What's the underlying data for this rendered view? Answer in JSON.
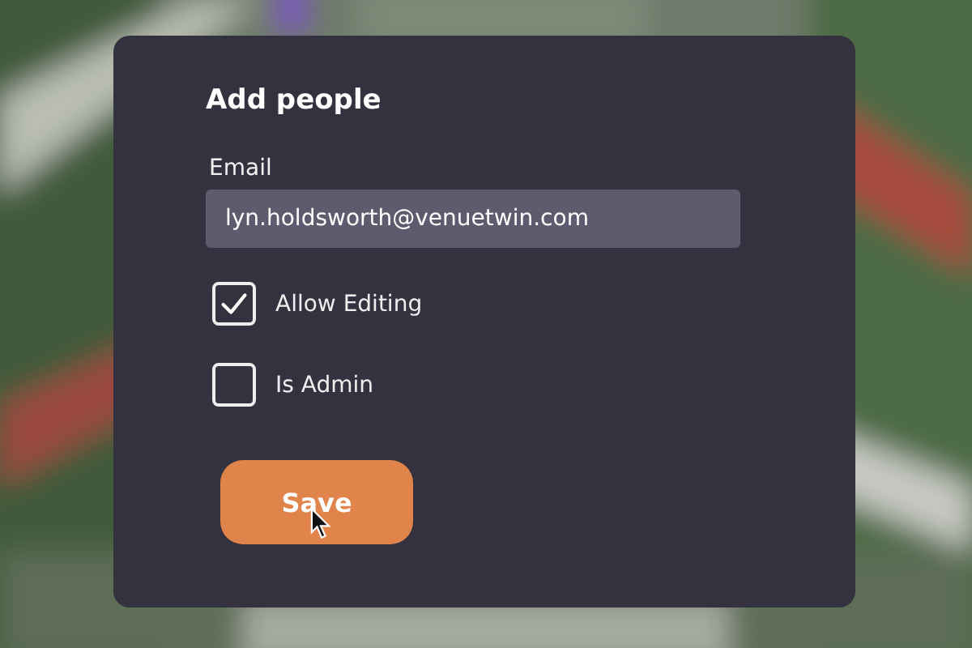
{
  "dialog": {
    "title": "Add people",
    "email": {
      "label": "Email",
      "value": "lyn.holdsworth@venuetwin.com"
    },
    "options": [
      {
        "label": "Allow Editing",
        "checked": true
      },
      {
        "label": "Is Admin",
        "checked": false
      }
    ],
    "save_button": "Save"
  }
}
